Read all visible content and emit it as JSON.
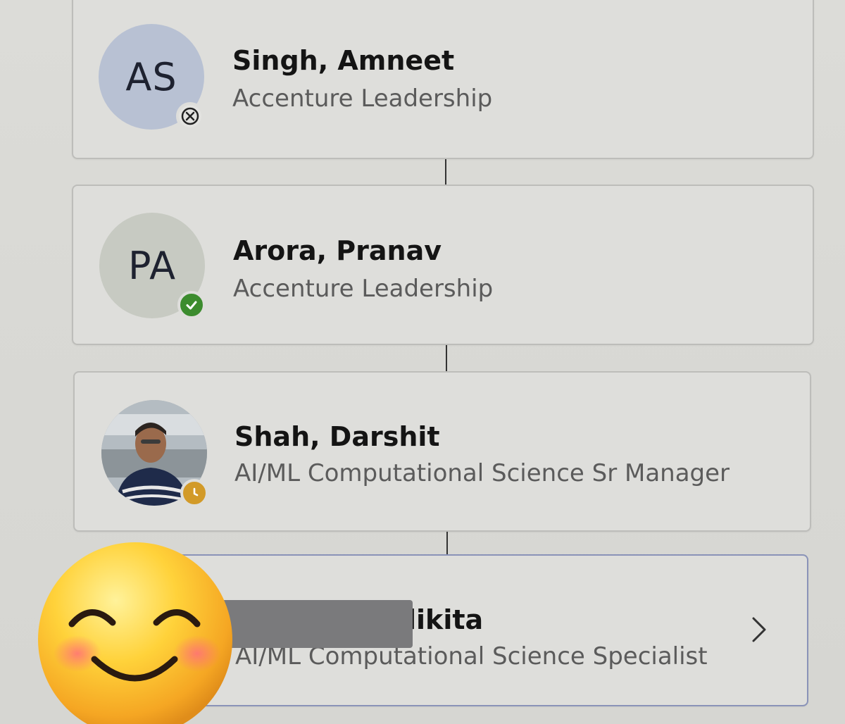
{
  "org_chart": {
    "people": [
      {
        "initials": "AS",
        "name": "Singh, Amneet",
        "title": "Accenture Leadership",
        "presence": "offline"
      },
      {
        "initials": "PA",
        "name": "Arora, Pranav",
        "title": "Accenture Leadership",
        "presence": "available"
      },
      {
        "initials": "",
        "name": "Shah, Darshit",
        "title": "AI/ML Computational Science Sr Manager",
        "presence": "away"
      },
      {
        "initials": "",
        "name": "likita",
        "title": "AI/ML Computational Science Specialist",
        "presence": ""
      }
    ]
  },
  "colors": {
    "available": "#3c8c2e",
    "away": "#d29a28",
    "offline": "#e3e3e0"
  },
  "icons": {
    "offline": "offline-x-icon",
    "available": "available-check-icon",
    "away": "away-clock-icon",
    "expand": "chevron-right-icon"
  }
}
